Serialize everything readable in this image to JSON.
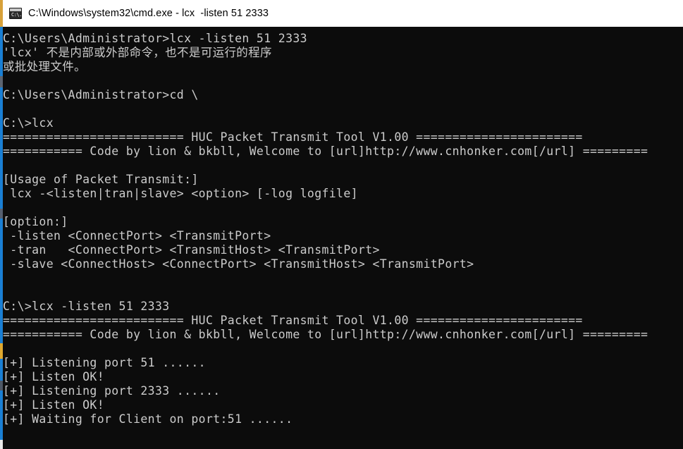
{
  "window": {
    "title": "C:\\Windows\\system32\\cmd.exe - lcx  -listen 51 2333",
    "icon": "cmd-console-icon",
    "icon_glyph": "C:\\.",
    "titlebar_bg": "#ffffff",
    "titlebar_fg": "#000000",
    "console_bg": "#0c0c0c",
    "console_fg": "#cccccc"
  },
  "background_window": {
    "accent_blue": "#1a7fd4",
    "accent_yellow": "#d8a13a"
  },
  "console": {
    "lines": [
      "C:\\Users\\Administrator>lcx -listen 51 2333",
      "'lcx' 不是内部或外部命令，也不是可运行的程序",
      "或批处理文件。",
      "",
      "C:\\Users\\Administrator>cd \\",
      "",
      "C:\\>lcx",
      "========================= HUC Packet Transmit Tool V1.00 =======================",
      "=========== Code by lion & bkbll, Welcome to [url]http://www.cnhonker.com[/url] =========",
      "",
      "[Usage of Packet Transmit:]",
      " lcx -<listen|tran|slave> <option> [-log logfile]",
      "",
      "[option:]",
      " -listen <ConnectPort> <TransmitPort>",
      " -tran   <ConnectPort> <TransmitHost> <TransmitPort>",
      " -slave <ConnectHost> <ConnectPort> <TransmitHost> <TransmitPort>",
      "",
      "",
      "C:\\>lcx -listen 51 2333",
      "========================= HUC Packet Transmit Tool V1.00 =======================",
      "=========== Code by lion & bkbll, Welcome to [url]http://www.cnhonker.com[/url] =========",
      "",
      "[+] Listening port 51 ......",
      "[+] Listen OK!",
      "[+] Listening port 2333 ......",
      "[+] Listen OK!",
      "[+] Waiting for Client on port:51 ......"
    ]
  }
}
